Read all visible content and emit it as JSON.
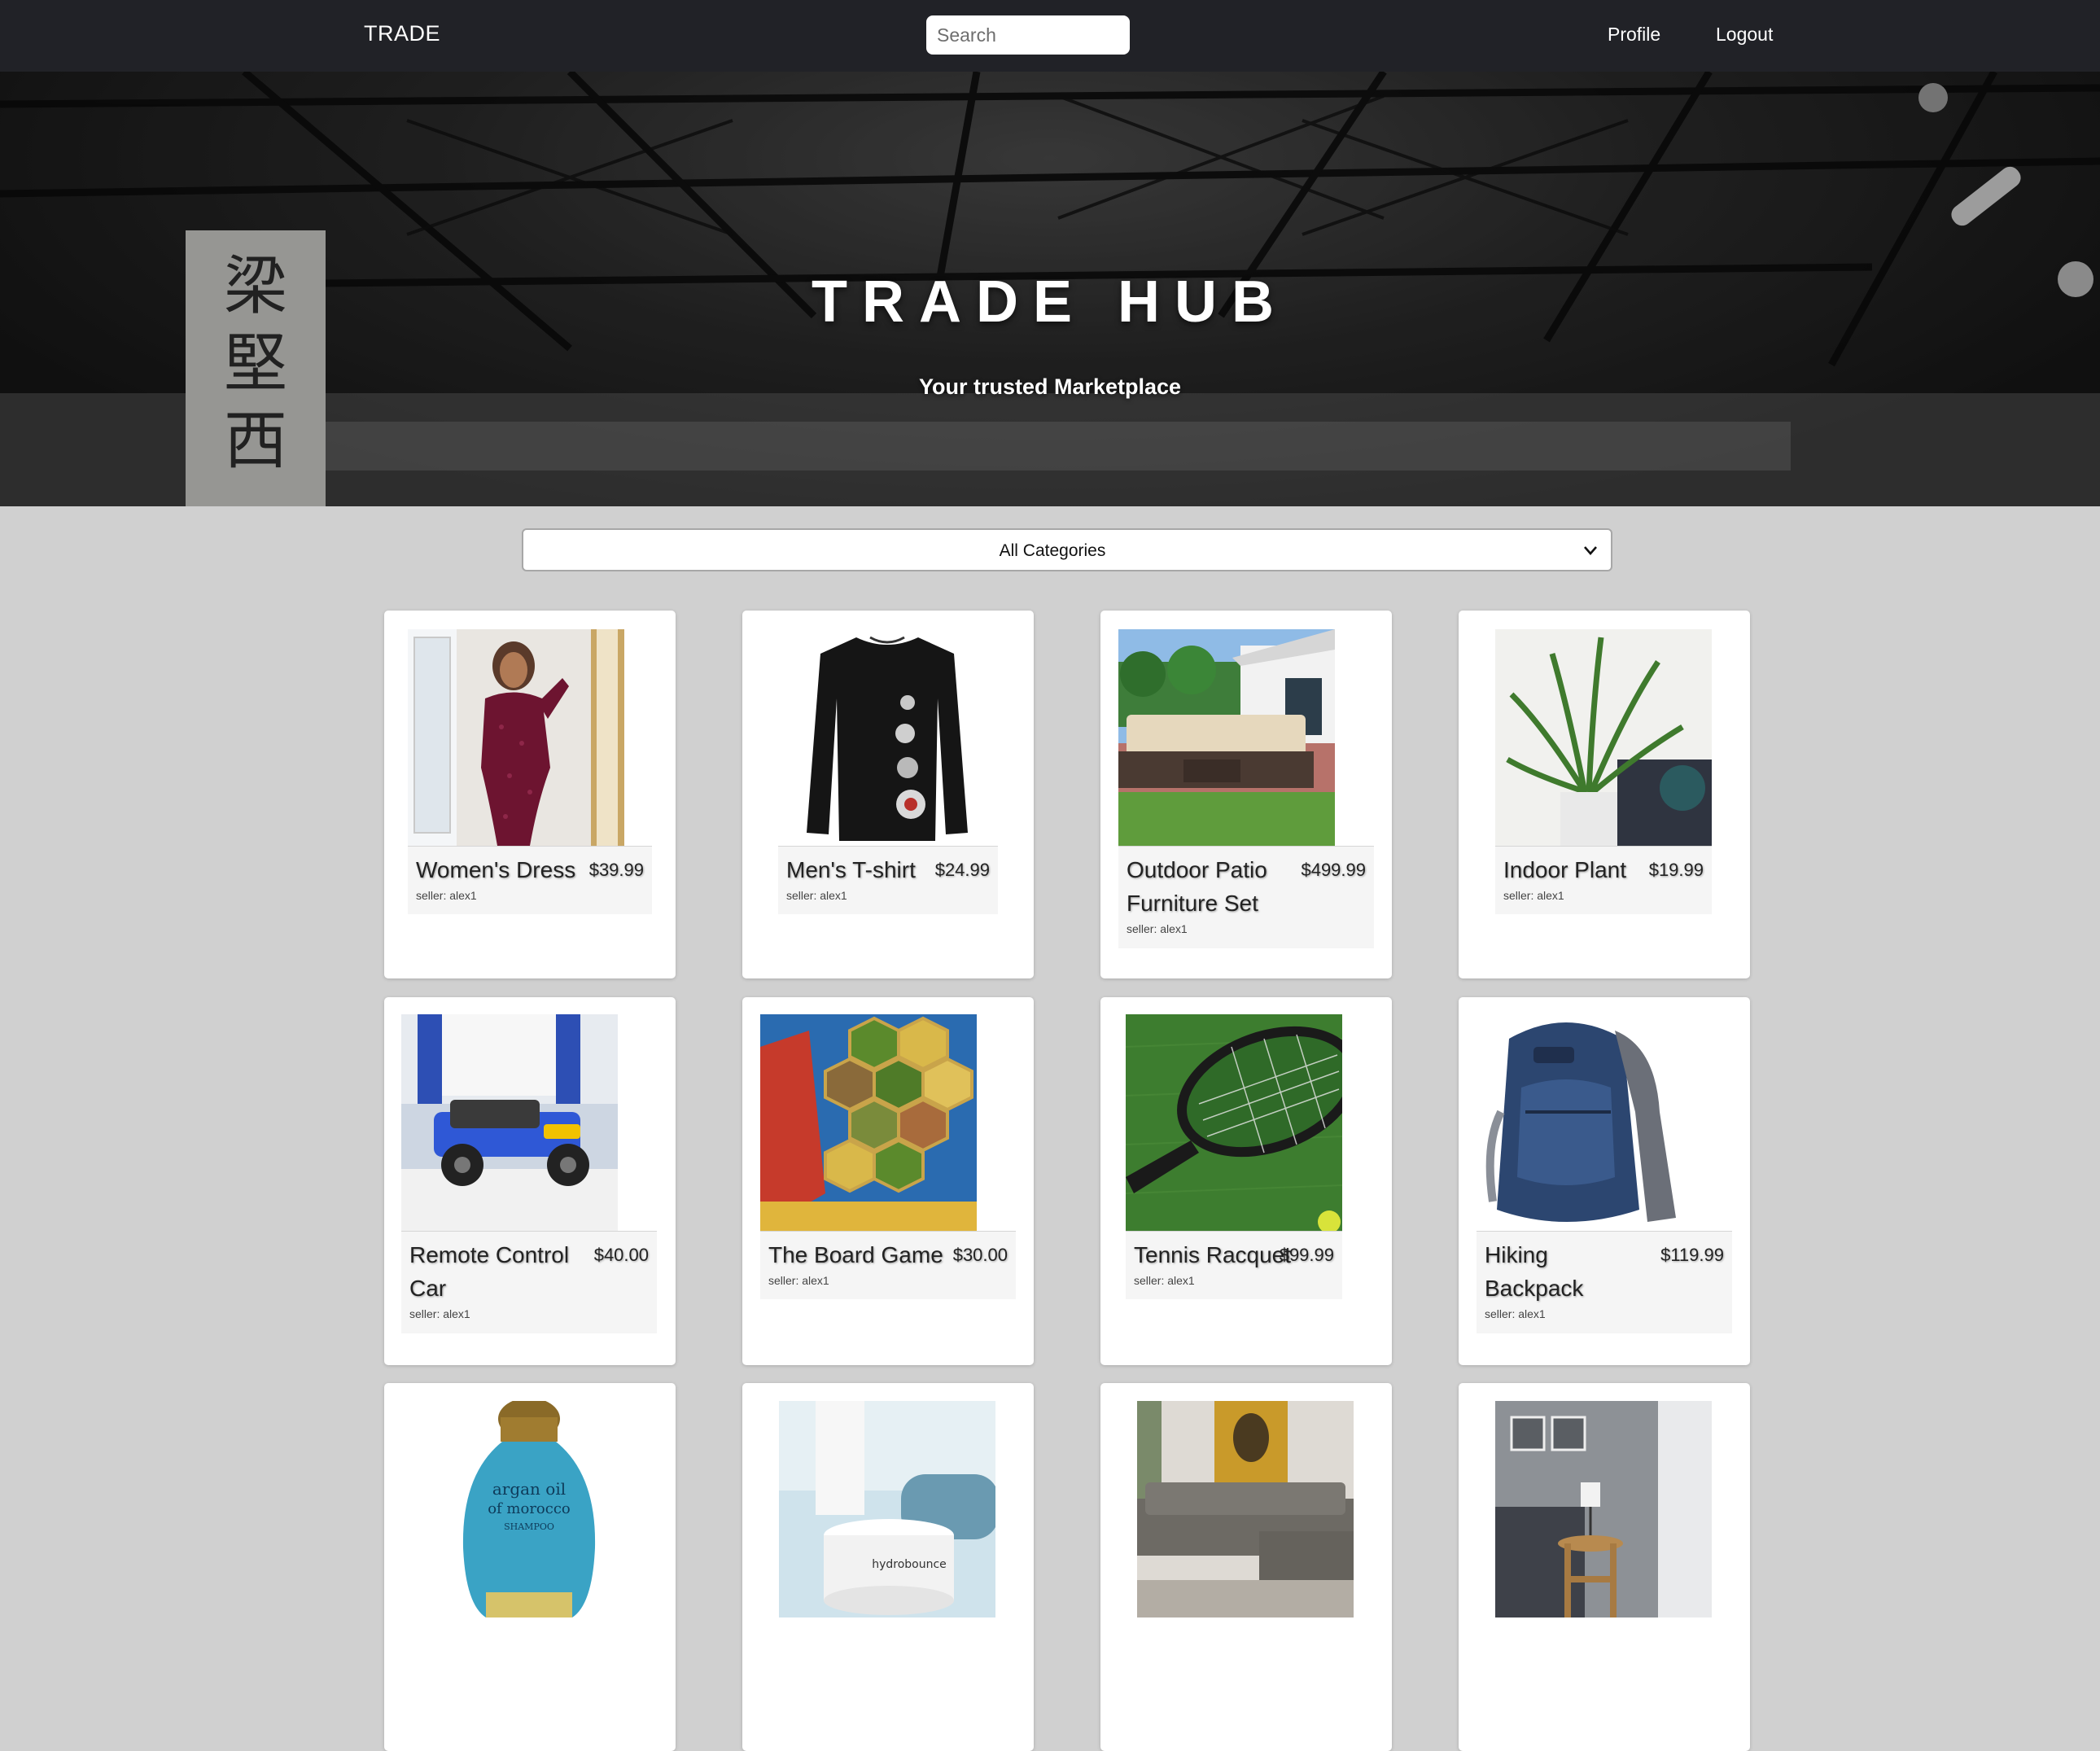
{
  "navbar": {
    "brand": "TRADE",
    "search_placeholder": "Search",
    "links": {
      "profile": "Profile",
      "logout": "Logout"
    }
  },
  "hero": {
    "title": "TRADE HUB",
    "subtitle": "Your trusted Marketplace"
  },
  "category_filter": {
    "selected": "All Categories"
  },
  "products": [
    {
      "name": "Women's Dress",
      "price": "$39.99",
      "seller": "seller: alex1"
    },
    {
      "name": "Men's T-shirt",
      "price": "$24.99",
      "seller": "seller: alex1"
    },
    {
      "name": "Outdoor Patio Furniture Set",
      "price": "$499.99",
      "seller": "seller: alex1"
    },
    {
      "name": "Indoor Plant",
      "price": "$19.99",
      "seller": "seller: alex1"
    },
    {
      "name": "Remote Control Car",
      "price": "$40.00",
      "seller": "seller: alex1"
    },
    {
      "name": "The Board Game",
      "price": "$30.00",
      "seller": "seller: alex1"
    },
    {
      "name": "Tennis Racquet",
      "price": "$99.99",
      "seller": "seller: alex1"
    },
    {
      "name": "Hiking Backpack",
      "price": "$119.99",
      "seller": "seller: alex1"
    }
  ],
  "more_products_images": [
    "shampoo-bottle",
    "face-cream-jar",
    "living-room-sofa",
    "side-table-room"
  ],
  "colors": {
    "navbar": "#212227",
    "page_background": "#d0d0d0",
    "card": "#ffffff",
    "card_info": "#f5f5f5"
  }
}
